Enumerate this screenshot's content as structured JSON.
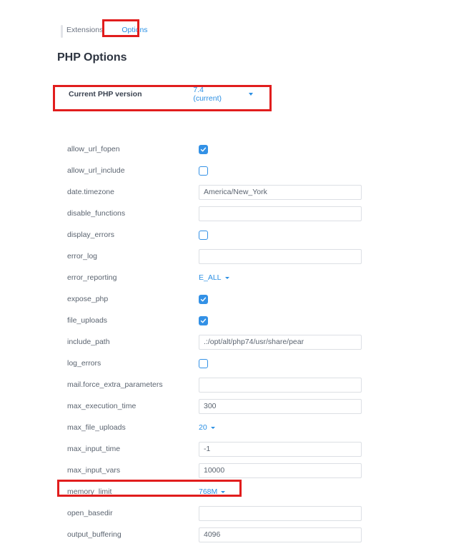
{
  "tabs": {
    "extensions": "Extensions",
    "options": "Options"
  },
  "title": "PHP Options",
  "version": {
    "label": "Current PHP version",
    "value": "7.4 (current)"
  },
  "rows": {
    "allow_url_fopen": {
      "k": "allow_url_fopen"
    },
    "allow_url_include": {
      "k": "allow_url_include"
    },
    "date_timezone": {
      "k": "date.timezone",
      "v": "America/New_York"
    },
    "disable_functions": {
      "k": "disable_functions",
      "v": ""
    },
    "display_errors": {
      "k": "display_errors"
    },
    "error_log": {
      "k": "error_log",
      "v": ""
    },
    "error_reporting": {
      "k": "error_reporting",
      "v": "E_ALL"
    },
    "expose_php": {
      "k": "expose_php"
    },
    "file_uploads": {
      "k": "file_uploads"
    },
    "include_path": {
      "k": "include_path",
      "v": ".:/opt/alt/php74/usr/share/pear"
    },
    "log_errors": {
      "k": "log_errors"
    },
    "mail_force": {
      "k": "mail.force_extra_parameters",
      "v": ""
    },
    "max_exec": {
      "k": "max_execution_time",
      "v": "300"
    },
    "max_file_uploads": {
      "k": "max_file_uploads",
      "v": "20"
    },
    "max_input_time": {
      "k": "max_input_time",
      "v": "-1"
    },
    "max_input_vars": {
      "k": "max_input_vars",
      "v": "10000"
    },
    "memory_limit": {
      "k": "memory_limit",
      "v": "768M"
    },
    "open_basedir": {
      "k": "open_basedir",
      "v": ""
    },
    "output_buffering": {
      "k": "output_buffering",
      "v": "4096"
    }
  },
  "highlight_color": "#e11d1d"
}
